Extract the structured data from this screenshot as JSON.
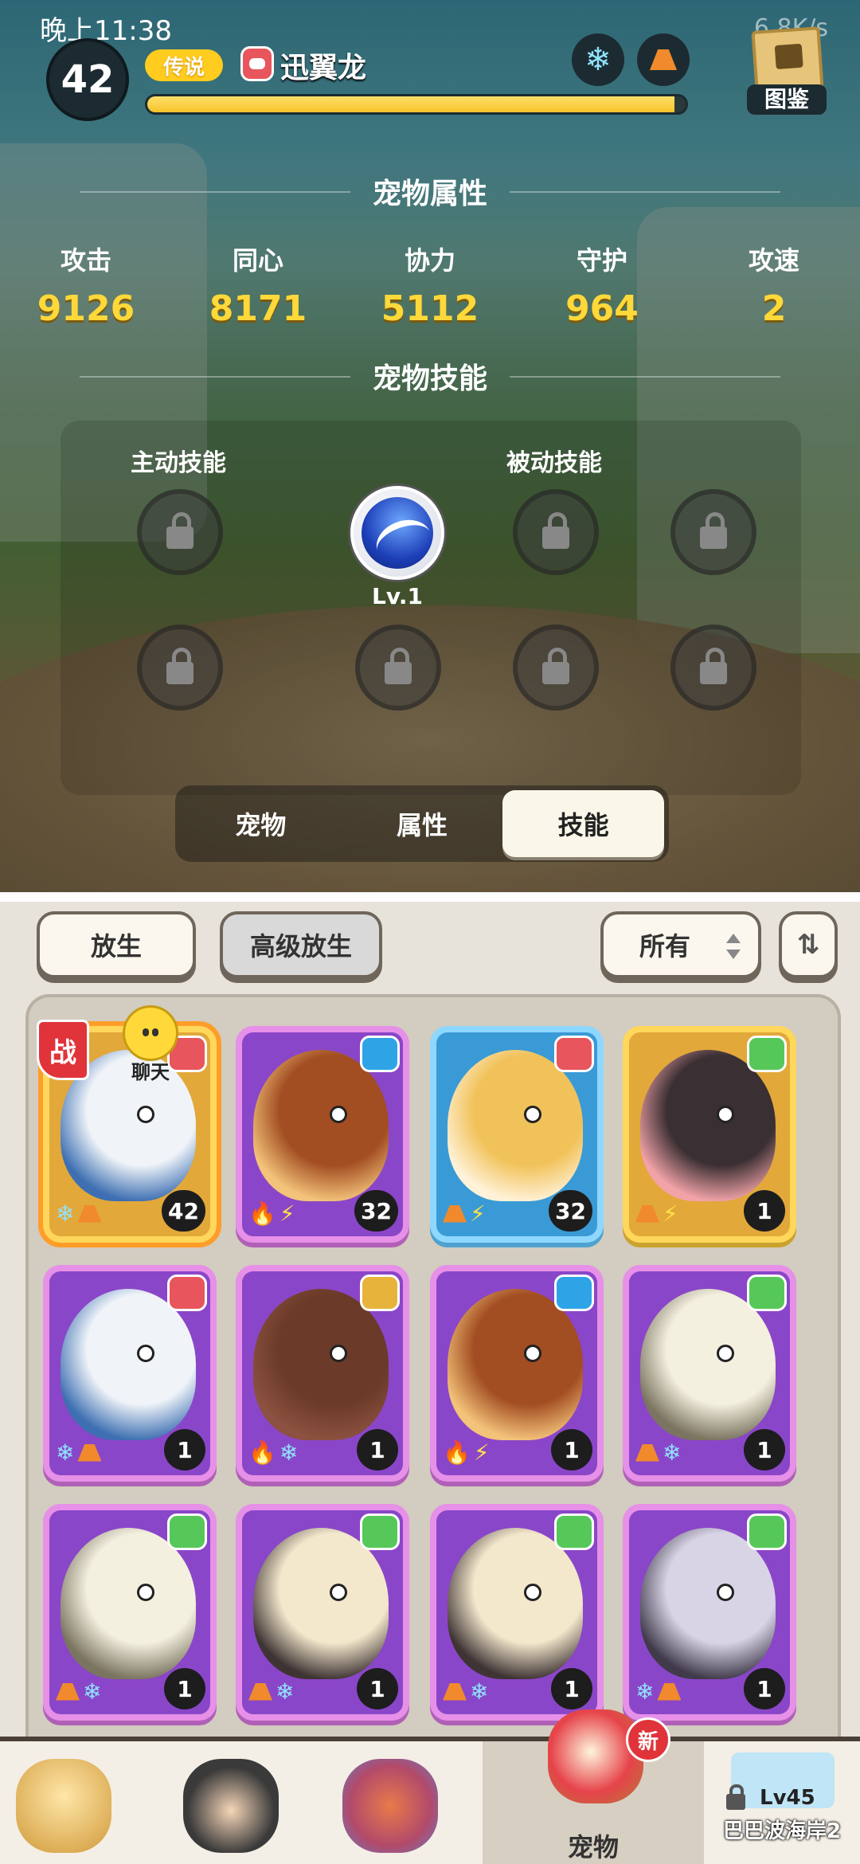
{
  "status_bar": {
    "time": "晚上11:38",
    "net_speed": "6.8K/s"
  },
  "pet": {
    "level": "42",
    "rarity": "传说",
    "name": "迅翼龙",
    "xp_fraction": 0.98
  },
  "atlas": {
    "label": "图鉴"
  },
  "attributes": {
    "title": "宠物属性",
    "items": [
      {
        "key": "攻击",
        "value": "9126"
      },
      {
        "key": "同心",
        "value": "8171"
      },
      {
        "key": "协力",
        "value": "5112"
      },
      {
        "key": "守护",
        "value": "964"
      },
      {
        "key": "攻速",
        "value": "2"
      }
    ]
  },
  "skills": {
    "title": "宠物技能",
    "active_label": "主动技能",
    "passive_label": "被动技能",
    "equipped_level": "Lv.1"
  },
  "tabs": [
    {
      "label": "宠物",
      "active": false
    },
    {
      "label": "属性",
      "active": false
    },
    {
      "label": "技能",
      "active": true
    }
  ],
  "actions": {
    "release": "放生",
    "advanced_release": "高级放生",
    "filter": "所有"
  },
  "cards": [
    {
      "level": "42",
      "rarity": "legend",
      "badge": "red",
      "elements": [
        "snow",
        "rock"
      ],
      "battle": "战",
      "chat": "聊天",
      "colors": [
        "#f0f4f8",
        "#3d6fb2"
      ]
    },
    {
      "level": "32",
      "rarity": "epic",
      "badge": "blue",
      "elements": [
        "fire",
        "bolt"
      ],
      "colors": [
        "#a24d22",
        "#f4c37a"
      ]
    },
    {
      "level": "32",
      "rarity": "rare",
      "badge": "red",
      "elements": [
        "rock",
        "bolt"
      ],
      "colors": [
        "#f1c25a",
        "#fff2d8"
      ]
    },
    {
      "level": "1",
      "rarity": "legend",
      "badge": "green",
      "elements": [
        "rock",
        "bolt"
      ],
      "colors": [
        "#3a2f33",
        "#f2a3a8"
      ]
    },
    {
      "level": "1",
      "rarity": "epic",
      "badge": "red",
      "elements": [
        "snow",
        "rock"
      ],
      "colors": [
        "#f0f4f8",
        "#3d6fb2"
      ]
    },
    {
      "level": "1",
      "rarity": "epic",
      "badge": "gold",
      "elements": [
        "fire",
        "snow"
      ],
      "colors": [
        "#6b3a28",
        "#8c5140"
      ]
    },
    {
      "level": "1",
      "rarity": "epic",
      "badge": "blue",
      "elements": [
        "fire",
        "bolt"
      ],
      "colors": [
        "#a24d22",
        "#f4c37a"
      ]
    },
    {
      "level": "1",
      "rarity": "epic",
      "badge": "green",
      "elements": [
        "rock",
        "snow"
      ],
      "colors": [
        "#f4f0e0",
        "#7a7460"
      ]
    },
    {
      "level": "1",
      "rarity": "epic",
      "badge": "green",
      "elements": [
        "rock",
        "snow"
      ],
      "colors": [
        "#f4f0e0",
        "#7a7460"
      ]
    },
    {
      "level": "1",
      "rarity": "epic",
      "badge": "green",
      "elements": [
        "rock",
        "snow"
      ],
      "colors": [
        "#f3e7cc",
        "#3f3434"
      ]
    },
    {
      "level": "1",
      "rarity": "epic",
      "badge": "green",
      "elements": [
        "rock",
        "snow"
      ],
      "colors": [
        "#f3e7cc",
        "#3f3434"
      ]
    },
    {
      "level": "1",
      "rarity": "epic",
      "badge": "green",
      "elements": [
        "snow",
        "rock"
      ],
      "colors": [
        "#d8d4e6",
        "#403a4a"
      ]
    }
  ],
  "nav": {
    "pets_label": "宠物",
    "new_badge": "新",
    "locked_level": "Lv45",
    "locked_area": "巴巴波海岸2"
  }
}
